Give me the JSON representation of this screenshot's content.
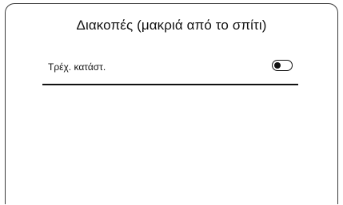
{
  "dialog": {
    "title": "Διακοπές (μακριά από το σπίτι)"
  },
  "setting": {
    "label": "Τρέχ. κατάστ.",
    "toggle_state": "off"
  }
}
